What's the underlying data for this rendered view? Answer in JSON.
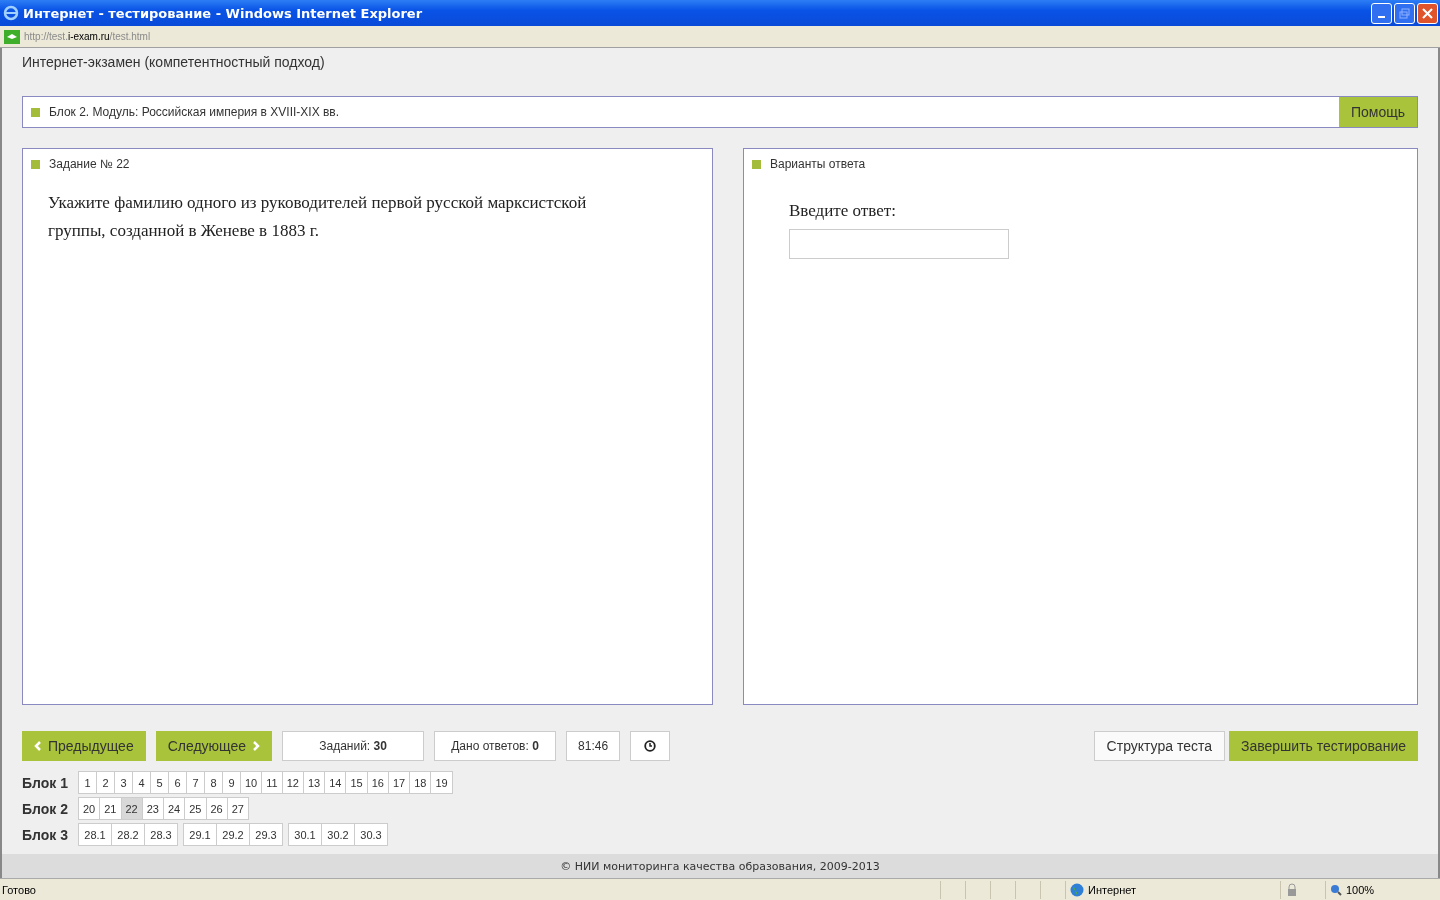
{
  "window": {
    "title": "Интернет - тестирование - Windows Internet Explorer"
  },
  "address": {
    "prefix": "http://test.",
    "domain": "i-exam.ru",
    "suffix": "/test.html"
  },
  "header": "Интернет-экзамен (компетентностный подход)",
  "module_bar": {
    "label": "Блок 2. Модуль: Российская империя в XVIII-XIX вв.",
    "help": "Помощь"
  },
  "task_panel": {
    "title": "Задание № 22",
    "text": "Укажите фамилию одного из руководителей первой русской марксистской группы, созданной в Женеве в 1883 г."
  },
  "answer_panel": {
    "title": "Варианты ответа",
    "prompt": "Введите ответ:"
  },
  "nav": {
    "prev": "Предыдущее",
    "next": "Следующее",
    "tasks_label": "Заданий:",
    "tasks_value": "30",
    "answers_label": "Дано ответов:",
    "answers_value": "0",
    "timer": "81:46",
    "structure": "Структура теста",
    "finish": "Завершить тестирование"
  },
  "blocks": [
    {
      "label": "Блок 1",
      "groups": [
        [
          {
            "n": "1",
            "selected": false
          },
          {
            "n": "2",
            "selected": false
          },
          {
            "n": "3",
            "selected": false
          },
          {
            "n": "4",
            "selected": false
          },
          {
            "n": "5",
            "selected": false
          },
          {
            "n": "6",
            "selected": false
          },
          {
            "n": "7",
            "selected": false
          },
          {
            "n": "8",
            "selected": false
          },
          {
            "n": "9",
            "selected": false
          },
          {
            "n": "10",
            "selected": false
          },
          {
            "n": "11",
            "selected": false
          },
          {
            "n": "12",
            "selected": false
          },
          {
            "n": "13",
            "selected": false
          },
          {
            "n": "14",
            "selected": false
          },
          {
            "n": "15",
            "selected": false
          },
          {
            "n": "16",
            "selected": false
          },
          {
            "n": "17",
            "selected": false
          },
          {
            "n": "18",
            "selected": false
          },
          {
            "n": "19",
            "selected": false
          }
        ]
      ]
    },
    {
      "label": "Блок 2",
      "groups": [
        [
          {
            "n": "20",
            "selected": false
          },
          {
            "n": "21",
            "selected": false
          },
          {
            "n": "22",
            "selected": true
          },
          {
            "n": "23",
            "selected": false
          },
          {
            "n": "24",
            "selected": false
          },
          {
            "n": "25",
            "selected": false
          },
          {
            "n": "26",
            "selected": false
          },
          {
            "n": "27",
            "selected": false
          }
        ]
      ]
    },
    {
      "label": "Блок 3",
      "groups": [
        [
          {
            "n": "28.1",
            "selected": false
          },
          {
            "n": "28.2",
            "selected": false
          },
          {
            "n": "28.3",
            "selected": false
          }
        ],
        [
          {
            "n": "29.1",
            "selected": false
          },
          {
            "n": "29.2",
            "selected": false
          },
          {
            "n": "29.3",
            "selected": false
          }
        ],
        [
          {
            "n": "30.1",
            "selected": false
          },
          {
            "n": "30.2",
            "selected": false
          },
          {
            "n": "30.3",
            "selected": false
          }
        ]
      ]
    }
  ],
  "footer": "© НИИ мониторинга качества образования, 2009-2013",
  "status_bar": {
    "text": "Готово",
    "zone": "Интернет",
    "zoom": "100%"
  }
}
